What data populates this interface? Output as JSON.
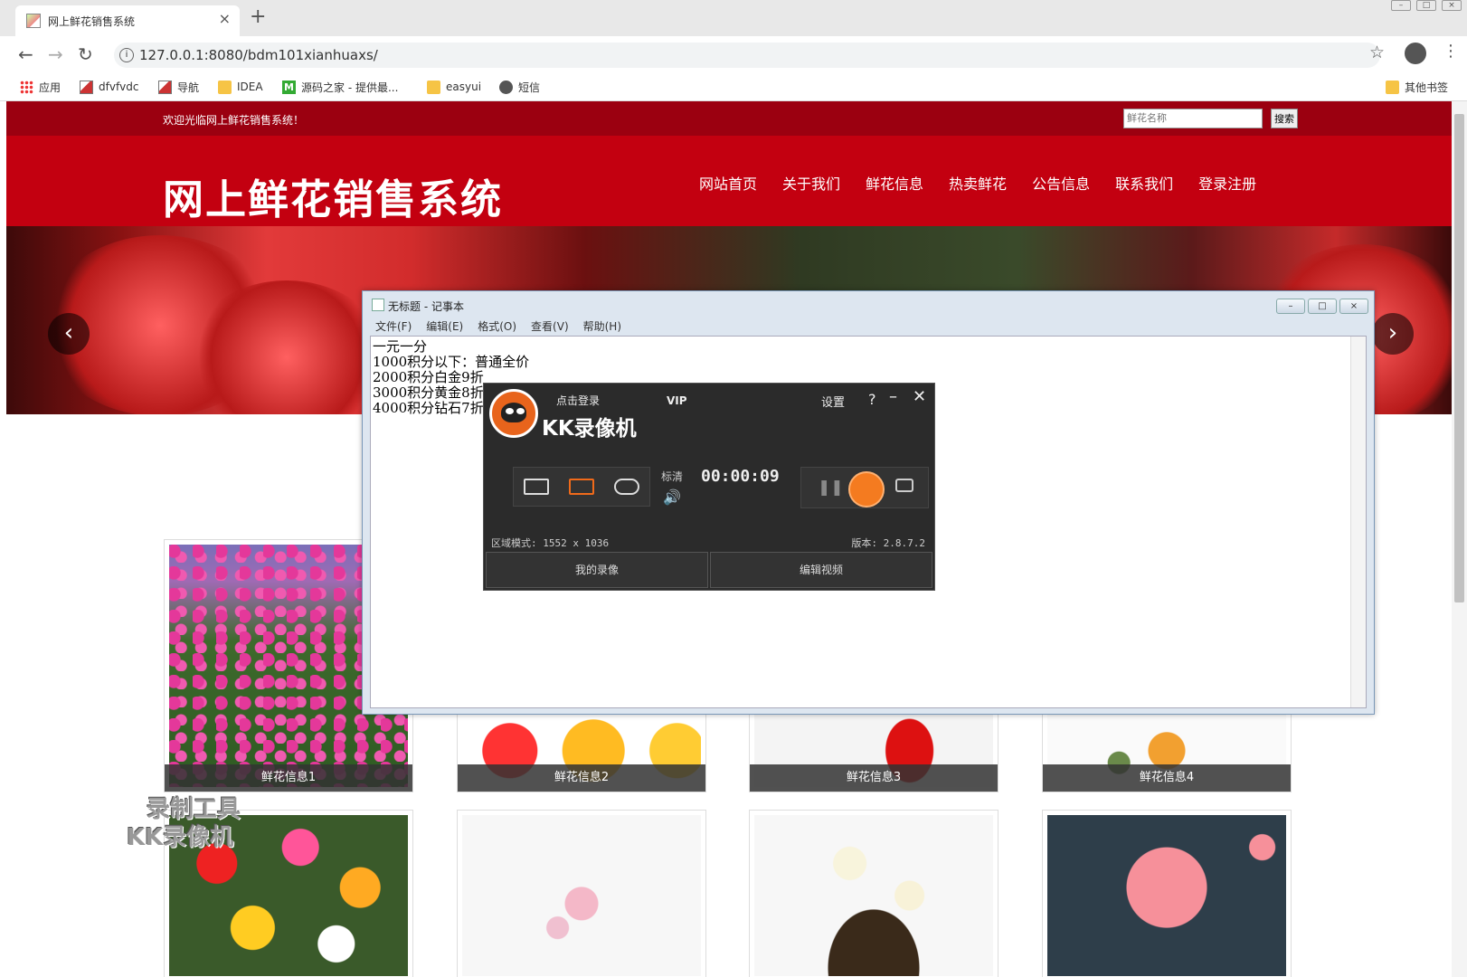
{
  "browser": {
    "tab_title": "网上鲜花销售系统",
    "tab_close": "×",
    "new_tab": "+",
    "url": "127.0.0.1:8080/bdm101xianhuaxs/",
    "bookmarks": [
      "应用",
      "dfvfvdc",
      "导航",
      "IDEA",
      "源码之家 - 提供最...",
      "easyui",
      "短信"
    ],
    "other_bookmarks": "其他书签"
  },
  "site": {
    "welcome": "欢迎光临网上鲜花销售系统！",
    "search_placeholder": "鲜花名称",
    "search_button": "搜索",
    "title": "网上鲜花销售系统",
    "nav": [
      "网站首页",
      "关于我们",
      "鲜花信息",
      "热卖鲜花",
      "公告信息",
      "联系我们",
      "登录注册"
    ],
    "prev_arrow": "‹",
    "next_arrow": "›",
    "products": [
      "鲜花信息1",
      "鲜花信息2",
      "鲜花信息3",
      "鲜花信息4"
    ]
  },
  "notepad": {
    "title": "无标题 - 记事本",
    "menu": [
      "文件(F)",
      "编辑(E)",
      "格式(O)",
      "查看(V)",
      "帮助(H)"
    ],
    "content": "一元一分\n1000积分以下：普通全价\n2000积分白金9折\n3000积分黄金8折\n4000积分钻石7折"
  },
  "kk": {
    "login": "点击登录",
    "vip": "VIP",
    "brand": "KK录像机",
    "settings": "设置",
    "help": "?",
    "quality": "标清",
    "timer": "00:00:09",
    "mode_text": "区域模式: 1552 x 1036",
    "version": "版本: 2.8.7.2",
    "my_recordings": "我的录像",
    "edit_video": "编辑视频"
  },
  "watermark": {
    "line1": "录制工具",
    "line2": "KK录像机"
  },
  "colors": {
    "topbar": "#9b0010",
    "header": "#c30010",
    "recorder_accent": "#f47b20"
  }
}
